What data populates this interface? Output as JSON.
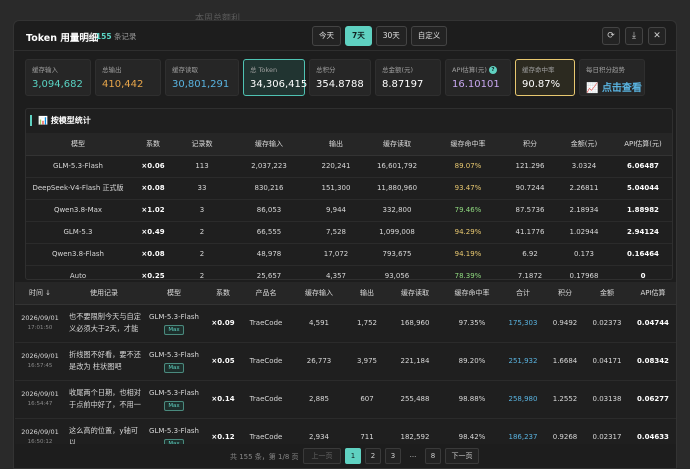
{
  "background": {
    "text": "本周总额利"
  },
  "header": {
    "title": "Token 用量明细",
    "sub_prefix": "共",
    "count": "155",
    "sub_suffix": "条记录",
    "tabs": [
      "今天",
      "7天",
      "30天",
      "自定义"
    ],
    "active_tab": "7天"
  },
  "cards": [
    {
      "label": "缓存输入",
      "value": "3,094,682",
      "color": "#59d3c3"
    },
    {
      "label": "总输出",
      "value": "410,442",
      "color": "#e8a64a"
    },
    {
      "label": "缓存读取",
      "value": "30,801,291",
      "color": "#59b3e0"
    },
    {
      "label": "总 Token",
      "value": "34,306,415",
      "color": "#ffffff"
    },
    {
      "label": "总积分",
      "value": "354.8788",
      "color": "#ffffff"
    },
    {
      "label": "总金额(元)",
      "value": "8.87197",
      "color": "#ffffff"
    },
    {
      "label": "API估算(元)",
      "value": "16.10101",
      "color": "#c7a7f0"
    },
    {
      "label": "缓存命中率",
      "value": "90.87%",
      "color": "#ffffff"
    },
    {
      "label": "每日积分趋势",
      "value": "点击查看",
      "color": "#59b3e0"
    }
  ],
  "model_panel": {
    "title": "按模型统计",
    "columns": [
      "模型",
      "系数",
      "记录数",
      "缓存输入",
      "输出",
      "缓存读取",
      "缓存命中率",
      "积分",
      "金额(元)",
      "API估算(元)"
    ],
    "rows": [
      [
        "GLM-5.3-Flash",
        "×0.06",
        "113",
        "2,037,223",
        "220,241",
        "16,601,792",
        "89.07%",
        "121.296",
        "3.0324",
        "6.06487"
      ],
      [
        "DeepSeek-V4-Flash 正式版",
        "×0.08",
        "33",
        "830,216",
        "151,300",
        "11,880,960",
        "93.47%",
        "90.7244",
        "2.26811",
        "5.04044"
      ],
      [
        "Qwen3.8-Max",
        "×1.02",
        "3",
        "86,053",
        "9,944",
        "332,800",
        "79.46%",
        "87.5736",
        "2.18934",
        "1.88982"
      ],
      [
        "GLM-5.3",
        "×0.49",
        "2",
        "66,555",
        "7,528",
        "1,099,008",
        "94.29%",
        "41.1776",
        "1.02944",
        "2.94124"
      ],
      [
        "Qwen3.8-Flash",
        "×0.08",
        "2",
        "48,978",
        "17,072",
        "793,675",
        "94.19%",
        "6.92",
        "0.173",
        "0.16464"
      ],
      [
        "Auto",
        "×0.25",
        "2",
        "25,657",
        "4,357",
        "93,056",
        "78.39%",
        "7.1872",
        "0.17968",
        "0"
      ]
    ]
  },
  "detail_table": {
    "columns": [
      "时间 ↓",
      "使用记录",
      "模型",
      "系数",
      "产品名",
      "缓存输入",
      "输出",
      "缓存读取",
      "缓存命中率",
      "合计",
      "积分",
      "金额",
      "API估算"
    ],
    "rows": [
      {
        "date": "2026/09/01",
        "time": "17:01:50",
        "record": "也不要限制今天与自定义必须大于2天，才能",
        "model": "GLM-5.3-Flash",
        "tag": "Max",
        "coef": "×0.09",
        "product": "TraeCode",
        "input": "4,591",
        "output": "1,752",
        "read": "168,960",
        "hit": "97.35%",
        "total": "175,303",
        "points": "0.9492",
        "amount": "0.02373",
        "api": "0.04744"
      },
      {
        "date": "2026/09/01",
        "time": "16:57:45",
        "record": "折线图不好看，要不还是改为 柱状图吧",
        "model": "GLM-5.3-Flash",
        "tag": "Max",
        "coef": "×0.05",
        "product": "TraeCode",
        "input": "26,773",
        "output": "3,975",
        "read": "221,184",
        "hit": "89.20%",
        "total": "251,932",
        "points": "1.6684",
        "amount": "0.04171",
        "api": "0.08342"
      },
      {
        "date": "2026/09/01",
        "time": "16:54:47",
        "record": "收尾两个日期，也相对于点前中好了，不用一",
        "model": "GLM-5.3-Flash",
        "tag": "Max",
        "coef": "×0.14",
        "product": "TraeCode",
        "input": "2,885",
        "output": "607",
        "read": "255,488",
        "hit": "98.88%",
        "total": "258,980",
        "points": "1.2552",
        "amount": "0.03138",
        "api": "0.06277"
      },
      {
        "date": "2026/09/01",
        "time": "16:50:12",
        "record": "这么高的位置，y轴可以",
        "model": "GLM-5.3-Flash",
        "tag": "Max",
        "coef": "×0.12",
        "product": "TraeCode",
        "input": "2,934",
        "output": "711",
        "read": "182,592",
        "hit": "98.42%",
        "total": "186,237",
        "points": "0.9268",
        "amount": "0.02317",
        "api": "0.04633"
      }
    ]
  },
  "pager": {
    "total": "共 155 条，第 1/8 页",
    "prev": "上一页",
    "pages": [
      "1",
      "2",
      "3",
      "...",
      "8"
    ],
    "next": "下一页"
  }
}
